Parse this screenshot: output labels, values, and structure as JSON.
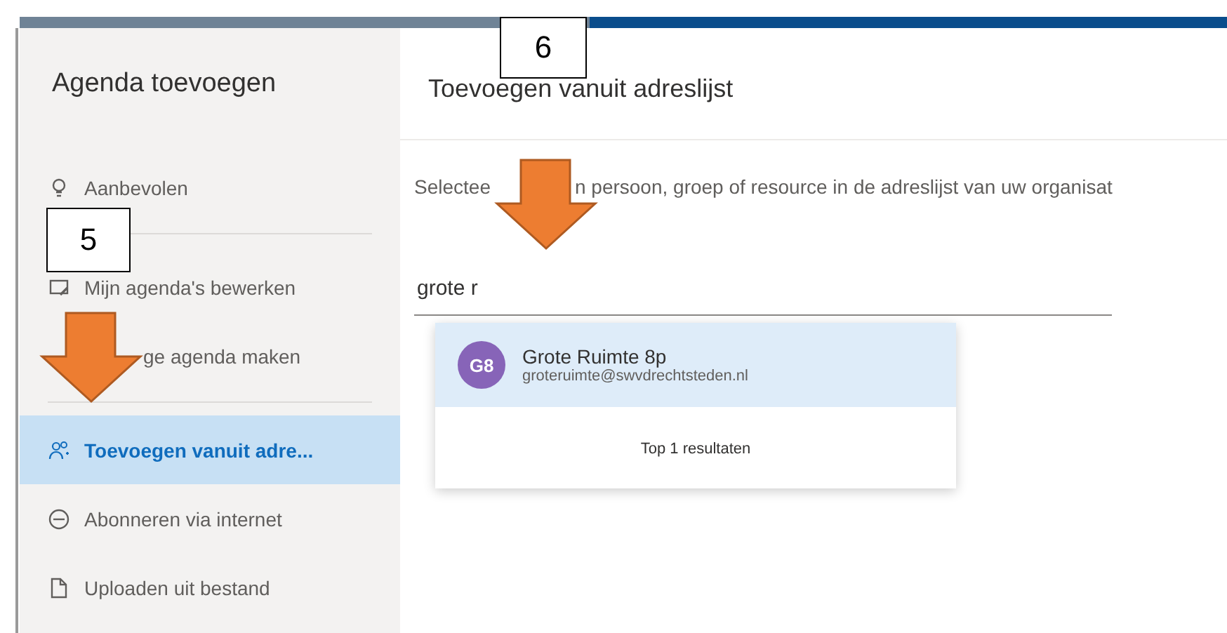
{
  "sidebar": {
    "title": "Agenda toevoegen",
    "sections": [
      [
        {
          "label": "Aanbevolen",
          "selected": false
        }
      ],
      [
        {
          "label": "Mijn agenda's bewerken",
          "selected": false
        },
        {
          "label": "ge agenda maken",
          "selected": false
        }
      ],
      [
        {
          "label": "Toevoegen vanuit adre...",
          "selected": true
        },
        {
          "label": "Abonneren via internet",
          "selected": false
        },
        {
          "label": "Uploaden uit bestand",
          "selected": false
        }
      ]
    ]
  },
  "content": {
    "title": "Toevoegen vanuit adreslijst",
    "description_start": "Selectee",
    "description_end": "n persoon, groep of resource in de adreslijst van uw organisat",
    "search": {
      "value": "grote r"
    },
    "suggestions": [
      {
        "initials": "G8",
        "name": "Grote Ruimte 8p",
        "email": "groteruimte@swvdrechtsteden.nl",
        "selected": true
      }
    ],
    "footer": "Top 1 resultaten"
  },
  "callouts": [
    {
      "kind": "number",
      "label": "6"
    },
    {
      "kind": "number",
      "label": "5"
    },
    {
      "kind": "arrow"
    },
    {
      "kind": "arrow"
    }
  ]
}
